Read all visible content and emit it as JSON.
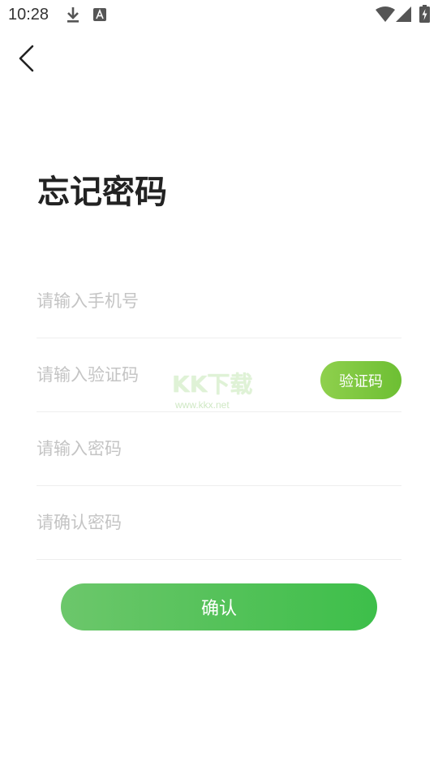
{
  "status_bar": {
    "time": "10:28",
    "icons": [
      "download-icon",
      "text-a-icon",
      "wifi-icon",
      "cell-signal-icon",
      "battery-charging-icon"
    ]
  },
  "header": {
    "back_icon": "chevron-left-icon"
  },
  "page": {
    "title": "忘记密码"
  },
  "form": {
    "phone": {
      "placeholder": "请输入手机号",
      "value": ""
    },
    "code": {
      "placeholder": "请输入验证码",
      "value": "",
      "button_label": "验证码"
    },
    "password": {
      "placeholder": "请输入密码",
      "value": ""
    },
    "confirm_password": {
      "placeholder": "请确认密码",
      "value": ""
    },
    "submit_label": "确认"
  },
  "watermark": {
    "logo_text": "KK下载",
    "url": "www.kkx.net"
  },
  "colors": {
    "accent_green": "#3dbf4a",
    "code_button_green": "#7cc83c",
    "placeholder": "#c4c4c4",
    "divider": "#eeeeee",
    "title": "#222222"
  }
}
